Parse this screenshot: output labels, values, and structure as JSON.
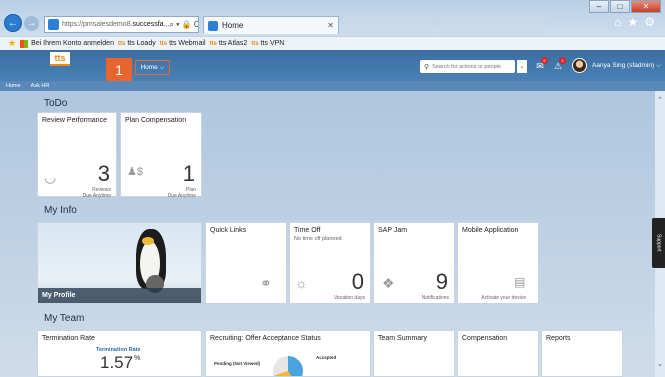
{
  "browser": {
    "url_prefix": "https://pmsalesdemo8.",
    "url_host": "successfa...",
    "addr_tools": "⌕ ▾ 🔒 C",
    "tab_title": "Home",
    "favorites": [
      {
        "label": "Bei Ihrem Konto anmelden"
      },
      {
        "label": "tts Loady",
        "tts": "tts"
      },
      {
        "label": "tts Webmail",
        "tts": "tts"
      },
      {
        "label": "tts Atlas2",
        "tts": "tts"
      },
      {
        "label": "tts VPN",
        "tts": "tts"
      }
    ]
  },
  "header": {
    "logo": "tts",
    "step_number": "1",
    "home_menu": "Home ⌵",
    "search_placeholder": "Search for actions or people",
    "notif_1": "5",
    "notif_2": "2",
    "user_name": "Aanya Sing (sfadmin) ⌵"
  },
  "subnav": {
    "home": "Home",
    "ask_hr": "Ask HR"
  },
  "sections": {
    "todo": "ToDo",
    "my_info": "My Info",
    "my_team": "My Team"
  },
  "tiles": {
    "review": {
      "title": "Review Performance",
      "number": "3",
      "cap1": "Reviews",
      "cap2": "Due Anytime"
    },
    "plan": {
      "title": "Plan Compensation",
      "number": "1",
      "cap1": "Plan",
      "cap2": "Due Anytime"
    },
    "profile": {
      "label": "My Profile"
    },
    "quick_links": {
      "title": "Quick Links"
    },
    "time_off": {
      "title": "Time Off",
      "subtitle": "No time off planned",
      "number": "0",
      "cap": "Vacation days"
    },
    "sap_jam": {
      "title": "SAP Jam",
      "number": "9",
      "cap": "Notifications"
    },
    "mobile": {
      "title": "Mobile Application",
      "cap": "Activate your device"
    },
    "termination": {
      "title": "Termination Rate",
      "inner_title": "Termination Rate",
      "value": "1.57",
      "unit": "%"
    },
    "recruiting": {
      "title": "Recruiting: Offer Acceptance Status",
      "label1": "Pending (Not Viewed)",
      "label2": "Accepted"
    },
    "team_summary": {
      "title": "Team Summary"
    },
    "compensation": {
      "title": "Compensation"
    },
    "reports": {
      "title": "Reports"
    }
  },
  "support": "Support"
}
